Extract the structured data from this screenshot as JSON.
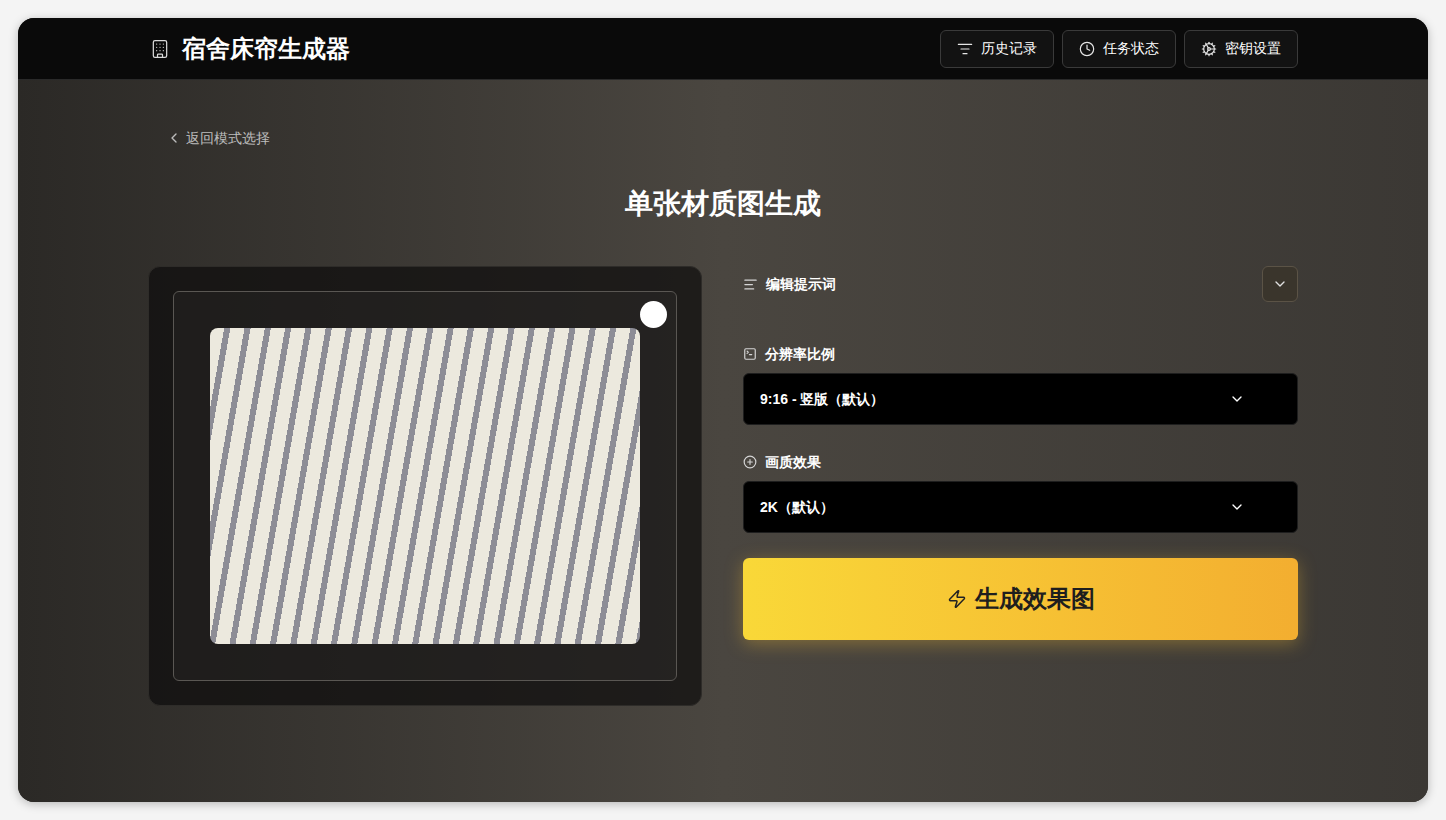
{
  "header": {
    "title": "宿舍床帘生成器",
    "buttons": [
      {
        "label": "历史记录",
        "icon": "history"
      },
      {
        "label": "任务状态",
        "icon": "clock"
      },
      {
        "label": "密钥设置",
        "icon": "settings"
      }
    ]
  },
  "back_link": "返回模式选择",
  "page_title": "单张材质图生成",
  "image_panel": {
    "selected": true
  },
  "prompt": {
    "label": "编辑提示词",
    "expanded": false
  },
  "fields": [
    {
      "label": "分辨率比例",
      "value": "9:16 - 竖版（默认）",
      "icon": "ratio"
    },
    {
      "label": "画质效果",
      "value": "2K（默认）",
      "icon": "quality"
    }
  ],
  "generate_button": "生成效果图"
}
